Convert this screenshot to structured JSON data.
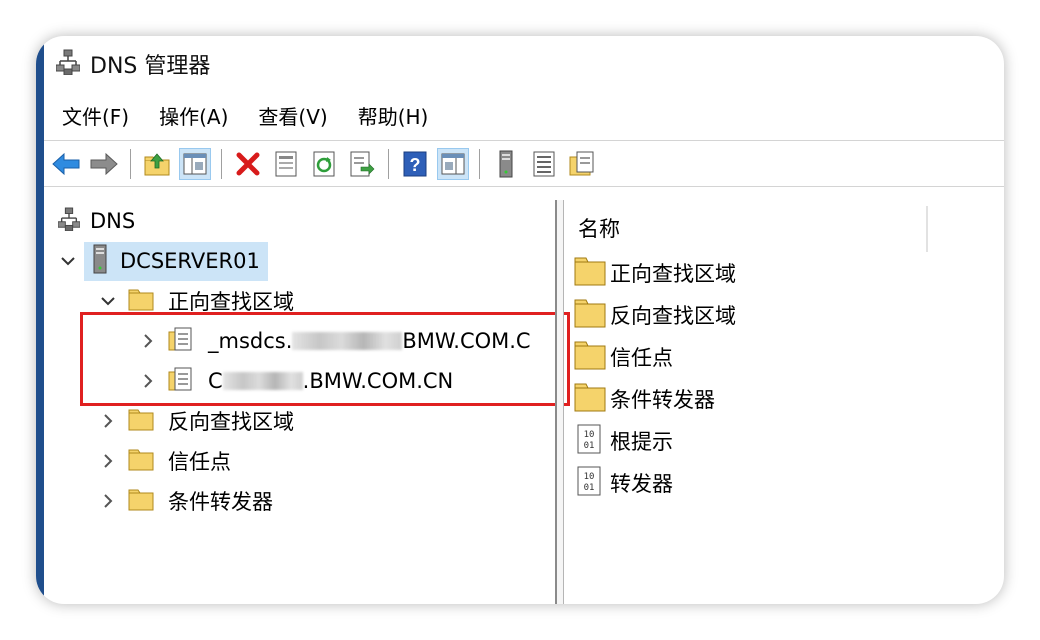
{
  "window": {
    "title": "DNS 管理器",
    "title_icon": "dns-server-icon"
  },
  "menu": {
    "items": [
      "文件(F)",
      "操作(A)",
      "查看(V)",
      "帮助(H)"
    ]
  },
  "toolbar": {
    "buttons": [
      "back-arrow-icon",
      "forward-arrow-icon",
      "up-folder-icon",
      "show-hide-tree-icon",
      "delete-icon",
      "properties-icon",
      "refresh-icon",
      "export-list-icon",
      "help-icon",
      "action-pane-icon",
      "server-icon",
      "list-icon",
      "zone-icon"
    ]
  },
  "tree": {
    "root": "DNS",
    "server": "DCSERVER01",
    "forward_zone": "正向查找区域",
    "zone1_prefix": "_msdcs.",
    "zone1_suffix": "BMW.COM.C",
    "zone2_prefix": "C",
    "zone2_suffix": ".BMW.COM.CN",
    "reverse_zone": "反向查找区域",
    "trust_points": "信任点",
    "conditional_forwarders": "条件转发器"
  },
  "list": {
    "header": "名称",
    "items": [
      {
        "label": "正向查找区域",
        "icon": "folder-icon"
      },
      {
        "label": "反向查找区域",
        "icon": "folder-icon"
      },
      {
        "label": "信任点",
        "icon": "folder-icon"
      },
      {
        "label": "条件转发器",
        "icon": "folder-icon"
      },
      {
        "label": "根提示",
        "icon": "binary-file-icon"
      },
      {
        "label": "转发器",
        "icon": "binary-file-icon"
      }
    ]
  },
  "colors": {
    "accent": "#1f4e8c",
    "selection": "#cce4f7",
    "highlight": "#e02020",
    "folder": "#f5d36b"
  }
}
